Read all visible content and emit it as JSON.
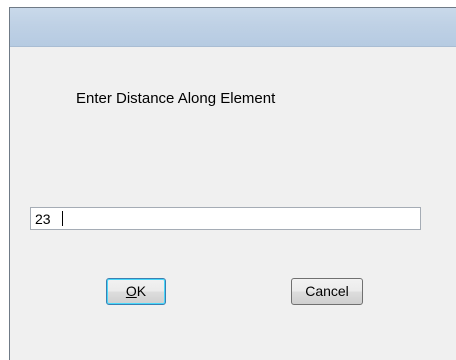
{
  "dialog": {
    "prompt": "Enter Distance Along Element",
    "value": "23",
    "ok_label_first": "O",
    "ok_label_rest": "K",
    "cancel_label": "Cancel"
  }
}
